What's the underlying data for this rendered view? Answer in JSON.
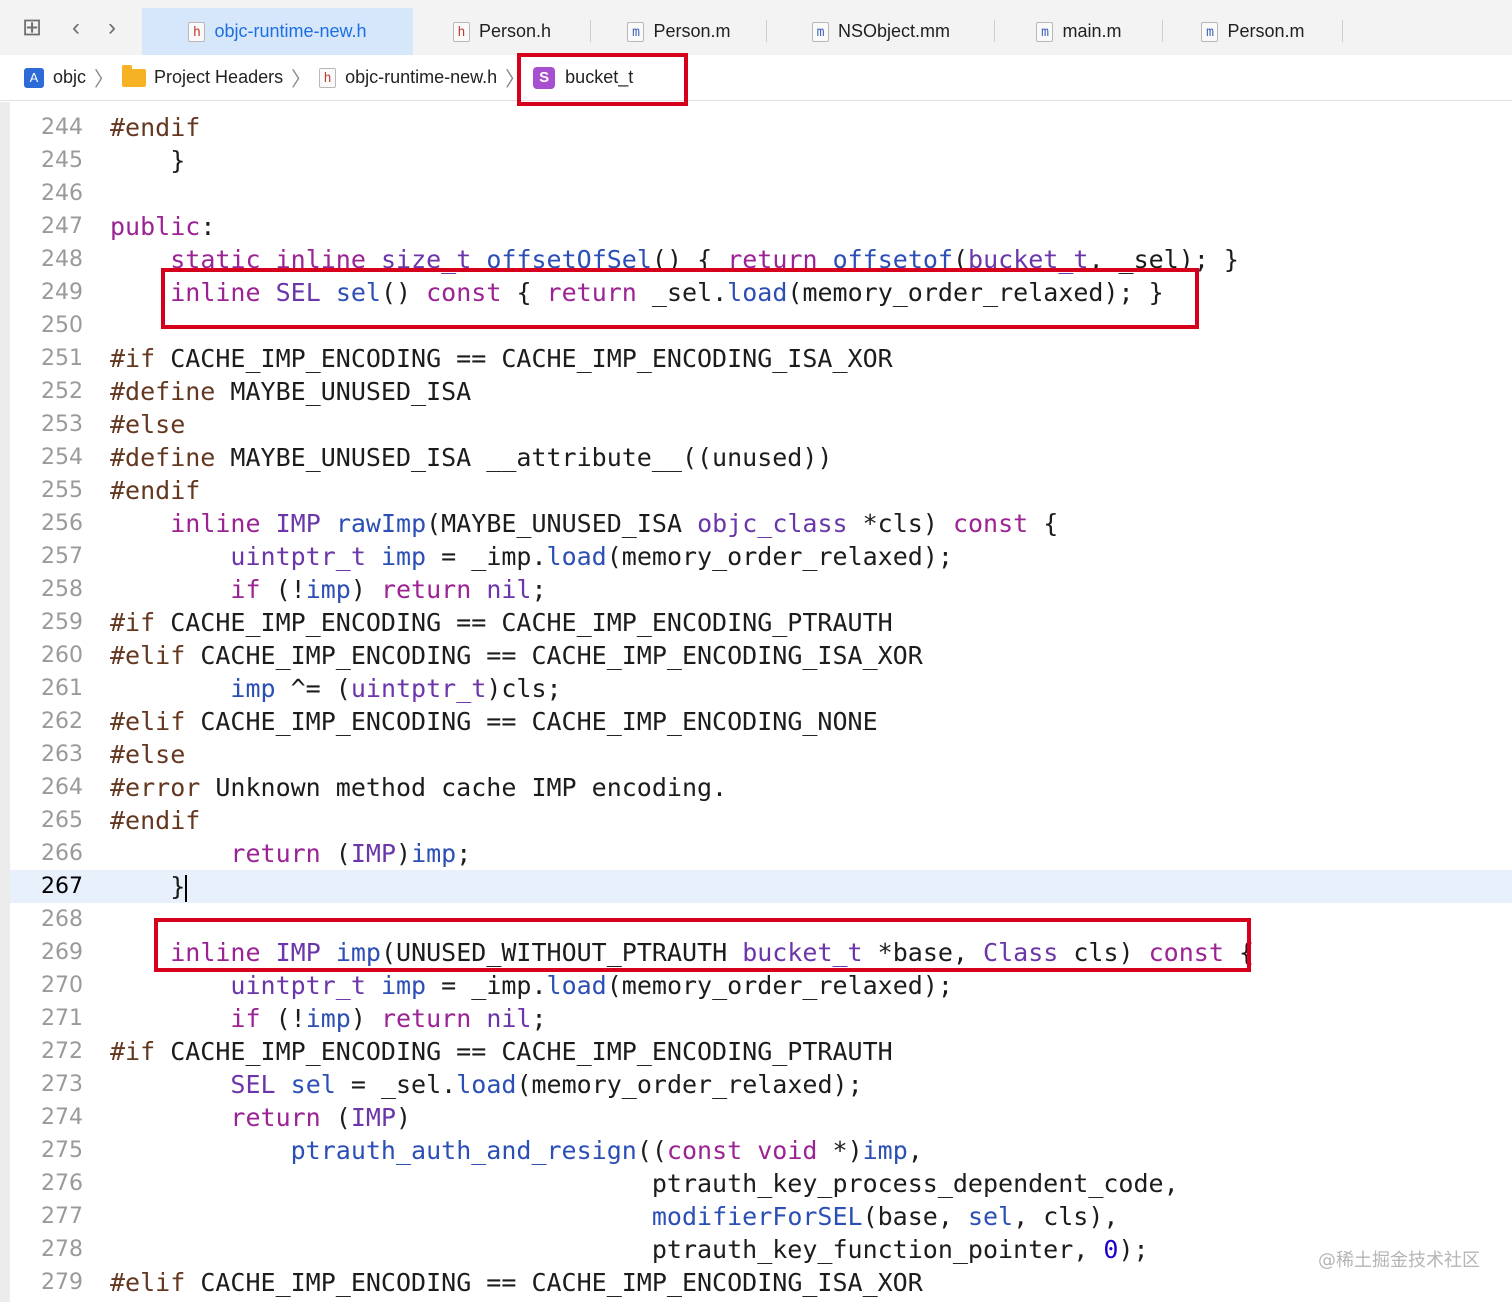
{
  "tabs": [
    {
      "label": "objc-runtime-new.h",
      "type": "h",
      "active": true
    },
    {
      "label": "Person.h",
      "type": "h",
      "active": false
    },
    {
      "label": "Person.m",
      "type": "m",
      "active": false
    },
    {
      "label": "NSObject.mm",
      "type": "m",
      "active": false
    },
    {
      "label": "main.m",
      "type": "m",
      "active": false
    },
    {
      "label": "Person.m",
      "type": "m",
      "active": false
    }
  ],
  "breadcrumb": {
    "project": "objc",
    "group": "Project Headers",
    "file": "objc-runtime-new.h",
    "symbol": "bucket_t",
    "symbol_badge": "S"
  },
  "editor": {
    "current_line": 267,
    "lines": [
      {
        "n": "244",
        "code": "#endif"
      },
      {
        "n": "245",
        "code": "    }"
      },
      {
        "n": "246",
        "code": ""
      },
      {
        "n": "247",
        "code": "public:"
      },
      {
        "n": "248",
        "code": "    static inline size_t offsetOfSel() { return offsetof(bucket_t, _sel); }"
      },
      {
        "n": "249",
        "code": "    inline SEL sel() const { return _sel.load(memory_order_relaxed); }"
      },
      {
        "n": "250",
        "code": ""
      },
      {
        "n": "251",
        "code": "#if CACHE_IMP_ENCODING == CACHE_IMP_ENCODING_ISA_XOR"
      },
      {
        "n": "252",
        "code": "#define MAYBE_UNUSED_ISA"
      },
      {
        "n": "253",
        "code": "#else"
      },
      {
        "n": "254",
        "code": "#define MAYBE_UNUSED_ISA __attribute__((unused))"
      },
      {
        "n": "255",
        "code": "#endif"
      },
      {
        "n": "256",
        "code": "    inline IMP rawImp(MAYBE_UNUSED_ISA objc_class *cls) const {"
      },
      {
        "n": "257",
        "code": "        uintptr_t imp = _imp.load(memory_order_relaxed);"
      },
      {
        "n": "258",
        "code": "        if (!imp) return nil;"
      },
      {
        "n": "259",
        "code": "#if CACHE_IMP_ENCODING == CACHE_IMP_ENCODING_PTRAUTH"
      },
      {
        "n": "260",
        "code": "#elif CACHE_IMP_ENCODING == CACHE_IMP_ENCODING_ISA_XOR"
      },
      {
        "n": "261",
        "code": "        imp ^= (uintptr_t)cls;"
      },
      {
        "n": "262",
        "code": "#elif CACHE_IMP_ENCODING == CACHE_IMP_ENCODING_NONE"
      },
      {
        "n": "263",
        "code": "#else"
      },
      {
        "n": "264",
        "code": "#error Unknown method cache IMP encoding."
      },
      {
        "n": "265",
        "code": "#endif"
      },
      {
        "n": "266",
        "code": "        return (IMP)imp;"
      },
      {
        "n": "267",
        "code": "    }"
      },
      {
        "n": "268",
        "code": ""
      },
      {
        "n": "269",
        "code": "    inline IMP imp(UNUSED_WITHOUT_PTRAUTH bucket_t *base, Class cls) const {"
      },
      {
        "n": "270",
        "code": "        uintptr_t imp = _imp.load(memory_order_relaxed);"
      },
      {
        "n": "271",
        "code": "        if (!imp) return nil;"
      },
      {
        "n": "272",
        "code": "#if CACHE_IMP_ENCODING == CACHE_IMP_ENCODING_PTRAUTH"
      },
      {
        "n": "273",
        "code": "        SEL sel = _sel.load(memory_order_relaxed);"
      },
      {
        "n": "274",
        "code": "        return (IMP)"
      },
      {
        "n": "275",
        "code": "            ptrauth_auth_and_resign((const void *)imp,"
      },
      {
        "n": "276",
        "code": "                                    ptrauth_key_process_dependent_code,"
      },
      {
        "n": "277",
        "code": "                                    modifierForSEL(base, sel, cls),"
      },
      {
        "n": "278",
        "code": "                                    ptrauth_key_function_pointer, 0);"
      },
      {
        "n": "279",
        "code": "#elif CACHE_IMP_ENCODING == CACHE_IMP_ENCODING_ISA_XOR"
      }
    ]
  },
  "watermark": "@稀土掘金技术社区",
  "colors": {
    "highlight_box": "#d6001c",
    "active_tab_bg": "#d7e7fb",
    "current_line_bg": "#e8f0fc",
    "keyword": "#9b2393",
    "type": "#6b36a9",
    "function": "#2c4fb5"
  }
}
